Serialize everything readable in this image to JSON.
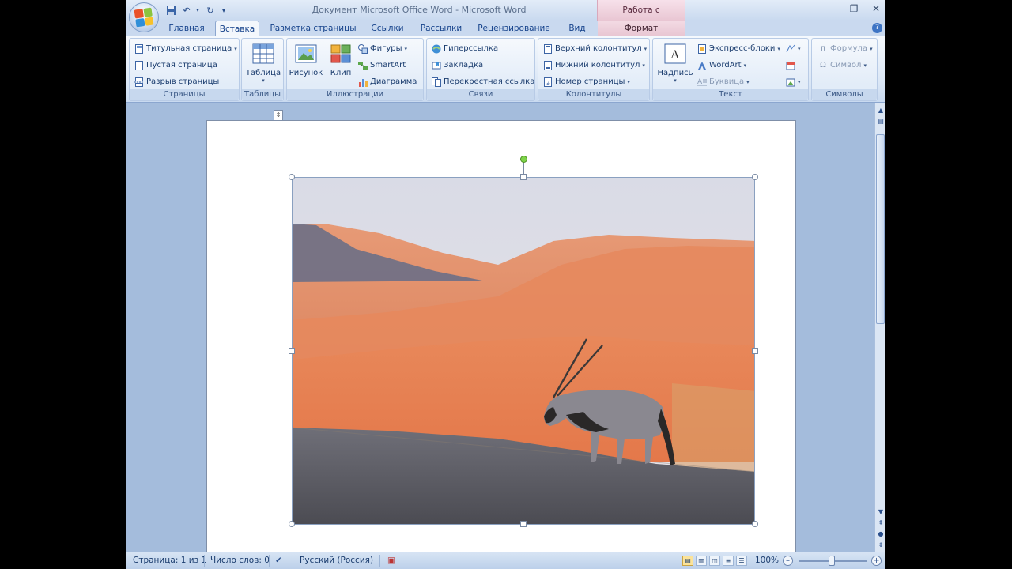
{
  "window": {
    "title": "Документ Microsoft Office Word - Microsoft Word",
    "contextual_group": "Работа с рисунками"
  },
  "tabs": [
    {
      "label": "Главная",
      "active": false
    },
    {
      "label": "Вставка",
      "active": true
    },
    {
      "label": "Разметка страницы",
      "active": false
    },
    {
      "label": "Ссылки",
      "active": false
    },
    {
      "label": "Рассылки",
      "active": false
    },
    {
      "label": "Рецензирование",
      "active": false
    },
    {
      "label": "Вид",
      "active": false
    },
    {
      "label": "Формат",
      "active": false,
      "contextual": true
    }
  ],
  "ribbon": {
    "pages": {
      "label": "Страницы",
      "items": [
        "Титульная страница",
        "Пустая страница",
        "Разрыв страницы"
      ]
    },
    "tables": {
      "label": "Таблицы",
      "table": "Таблица"
    },
    "illustrations": {
      "label": "Иллюстрации",
      "picture": "Рисунок",
      "clip": "Клип",
      "shapes": "Фигуры",
      "smartart": "SmartArt",
      "chart": "Диаграмма"
    },
    "links": {
      "label": "Связи",
      "hyperlink": "Гиперссылка",
      "bookmark": "Закладка",
      "crossref": "Перекрестная ссылка"
    },
    "headers": {
      "label": "Колонтитулы",
      "header": "Верхний колонтитул",
      "footer": "Нижний колонтитул",
      "page_number": "Номер страницы"
    },
    "text": {
      "label": "Текст",
      "textbox": "Надпись",
      "quickparts": "Экспресс-блоки",
      "wordart": "WordArt",
      "dropcap": "Буквица"
    },
    "symbols": {
      "label": "Символы",
      "equation": "Формула",
      "symbol": "Символ"
    }
  },
  "statusbar": {
    "page": "Страница: 1 из 1",
    "words": "Число слов: 0",
    "language": "Русский (Россия)",
    "zoom": "100%",
    "zoom_percent": 100
  },
  "colors": {
    "ribbon_bg": "#dbe7f6",
    "doc_bg": "#a4bcdc",
    "contextual_tab": "#e8c5d2",
    "selection_rotate_handle": "#7ed34a"
  }
}
